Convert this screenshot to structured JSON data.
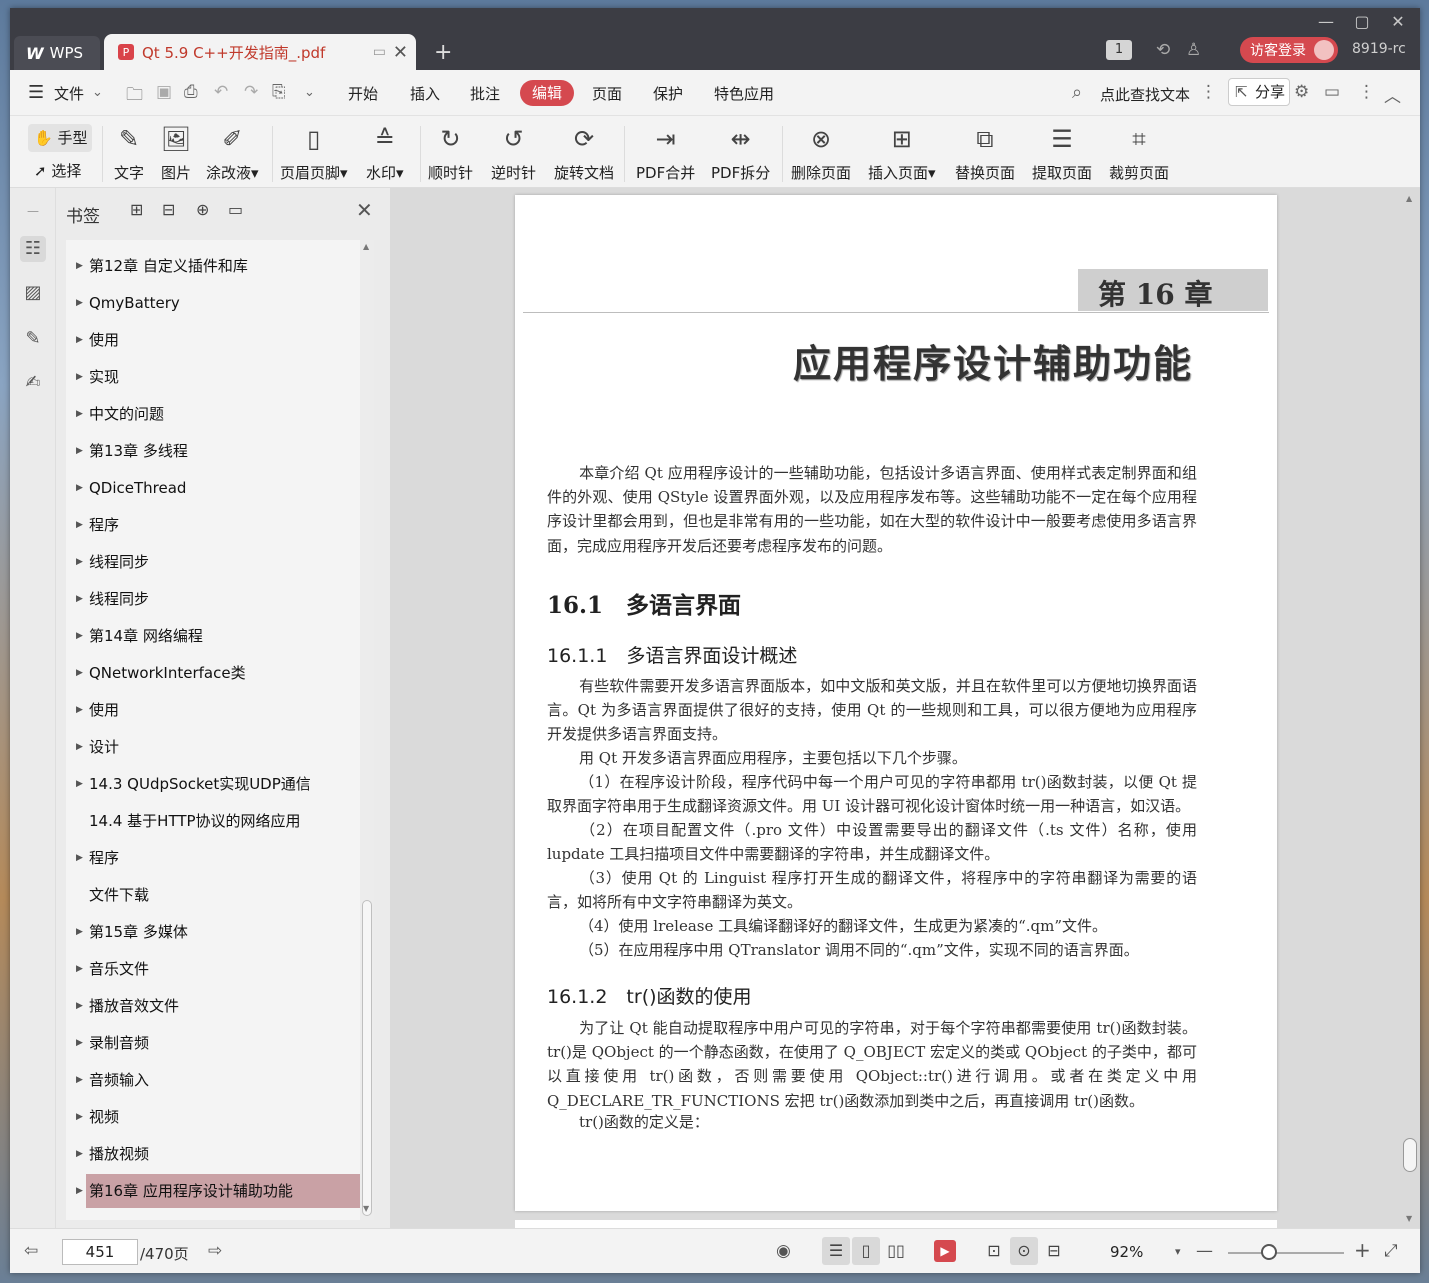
{
  "titlebar": {
    "app_tab": "WPS",
    "app_logo": "W",
    "doc_tab_title": "Qt 5.9 C++开发指南_.pdf",
    "pdf_badge": "P",
    "new_tab": "+",
    "window_count": "1",
    "login_label": "访客登录",
    "user_id": "8919-rc",
    "minimize": "—",
    "maximize": "▢",
    "close": "✕"
  },
  "menubar": {
    "hamburger": "☰",
    "file": "文件",
    "items": [
      "开始",
      "插入",
      "批注",
      "编辑",
      "页面",
      "保护",
      "特色应用"
    ],
    "active_item": "编辑",
    "search_placeholder": "点此查找文本",
    "share": "分享"
  },
  "ribbon": {
    "hand": "手型",
    "select": "选择",
    "buttons": [
      {
        "label": "文字",
        "icon": "text-edit-icon"
      },
      {
        "label": "图片",
        "icon": "image-icon"
      },
      {
        "label": "涂改液",
        "icon": "correction-pen-icon"
      },
      {
        "label": "页眉页脚",
        "icon": "header-footer-icon"
      },
      {
        "label": "水印",
        "icon": "watermark-icon"
      },
      {
        "label": "顺时针",
        "icon": "rotate-cw-icon"
      },
      {
        "label": "逆时针",
        "icon": "rotate-ccw-icon"
      },
      {
        "label": "旋转文档",
        "icon": "rotate-doc-icon"
      },
      {
        "label": "PDF合并",
        "icon": "merge-icon"
      },
      {
        "label": "PDF拆分",
        "icon": "split-icon"
      },
      {
        "label": "删除页面",
        "icon": "delete-page-icon"
      },
      {
        "label": "插入页面",
        "icon": "insert-page-icon"
      },
      {
        "label": "替换页面",
        "icon": "replace-page-icon"
      },
      {
        "label": "提取页面",
        "icon": "extract-page-icon"
      },
      {
        "label": "裁剪页面",
        "icon": "crop-page-icon"
      }
    ]
  },
  "bookmarks": {
    "title": "书签",
    "items": [
      {
        "label": "第12章 自定义插件和库",
        "expandable": true
      },
      {
        "label": "QmyBattery",
        "expandable": true
      },
      {
        "label": "使用",
        "expandable": true
      },
      {
        "label": "实现",
        "expandable": true
      },
      {
        "label": "中文的问题",
        "expandable": true
      },
      {
        "label": "第13章 多线程",
        "expandable": true
      },
      {
        "label": "QDiceThread",
        "expandable": true
      },
      {
        "label": "程序",
        "expandable": true
      },
      {
        "label": "线程同步",
        "expandable": true
      },
      {
        "label": "线程同步",
        "expandable": true
      },
      {
        "label": "第14章 网络编程",
        "expandable": true
      },
      {
        "label": "QNetworkInterface类",
        "expandable": true
      },
      {
        "label": "使用",
        "expandable": true
      },
      {
        "label": "设计",
        "expandable": true
      },
      {
        "label": "14.3 QUdpSocket实现UDP通信",
        "expandable": true
      },
      {
        "label": "14.4 基于HTTP协议的网络应用",
        "expandable": false
      },
      {
        "label": "程序",
        "expandable": true
      },
      {
        "label": "文件下载",
        "expandable": false
      },
      {
        "label": "第15章 多媒体",
        "expandable": true
      },
      {
        "label": "音乐文件",
        "expandable": true
      },
      {
        "label": "播放音效文件",
        "expandable": true
      },
      {
        "label": "录制音频",
        "expandable": true
      },
      {
        "label": "音频输入",
        "expandable": true
      },
      {
        "label": "视频",
        "expandable": true
      },
      {
        "label": "播放视频",
        "expandable": true
      },
      {
        "label": "第16章 应用程序设计辅助功能",
        "expandable": true,
        "selected": true
      }
    ]
  },
  "document": {
    "chapter_number": "第 16 章",
    "chapter_title": "应用程序设计辅助功能",
    "intro": "本章介绍 Qt 应用程序设计的一些辅助功能，包括设计多语言界面、使用样式表定制界面和组件的外观、使用 QStyle 设置界面外观，以及应用程序发布等。这些辅助功能不一定在每个应用程序设计里都会用到，但也是非常有用的一些功能，如在大型的软件设计中一般要考虑使用多语言界面，完成应用程序开发后还要考虑程序发布的问题。",
    "h2_1": "16.1　多语言界面",
    "h3_1": "16.1.1　多语言界面设计概述",
    "p1": "有些软件需要开发多语言界面版本，如中文版和英文版，并且在软件里可以方便地切换界面语言。Qt 为多语言界面提供了很好的支持，使用 Qt 的一些规则和工具，可以很方便地为应用程序开发提供多语言界面支持。",
    "p2": "用 Qt 开发多语言界面应用程序，主要包括以下几个步骤。",
    "p3": "（1）在程序设计阶段，程序代码中每一个用户可见的字符串都用 tr()函数封装，以便 Qt 提取界面字符串用于生成翻译资源文件。用 UI 设计器可视化设计窗体时统一用一种语言，如汉语。",
    "p4": "（2）在项目配置文件（.pro 文件）中设置需要导出的翻译文件（.ts 文件）名称，使用 lupdate 工具扫描项目文件中需要翻译的字符串，并生成翻译文件。",
    "p5": "（3）使用 Qt 的 Linguist 程序打开生成的翻译文件，将程序中的字符串翻译为需要的语言，如将所有中文字符串翻译为英文。",
    "p6": "（4）使用 lrelease 工具编译翻译好的翻译文件，生成更为紧凑的“.qm”文件。",
    "p7": "（5）在应用程序中用 QTranslator 调用不同的“.qm”文件，实现不同的语言界面。",
    "h3_2": "16.1.2　tr()函数的使用",
    "p8": "为了让 Qt 能自动提取程序中用户可见的字符串，对于每个字符串都需要使用 tr()函数封装。tr()是 QObject 的一个静态函数，在使用了 Q_OBJECT 宏定义的类或 QObject 的子类中，都可以直接使用 tr()函数，否则需要使用 QObject::tr()进行调用。或者在类定义中用 Q_DECLARE_TR_FUNCTIONS 宏把 tr()函数添加到类中之后，再直接调用 tr()函数。",
    "p9": "tr()函数的定义是："
  },
  "statusbar": {
    "current_page": "451",
    "total_pages": "/470页",
    "zoom": "92%",
    "zoom_fraction": 0.35
  },
  "colors": {
    "accent": "#d5494f",
    "titlebar": "#3c3d44",
    "selected_bookmark": "#c9a1a5"
  }
}
